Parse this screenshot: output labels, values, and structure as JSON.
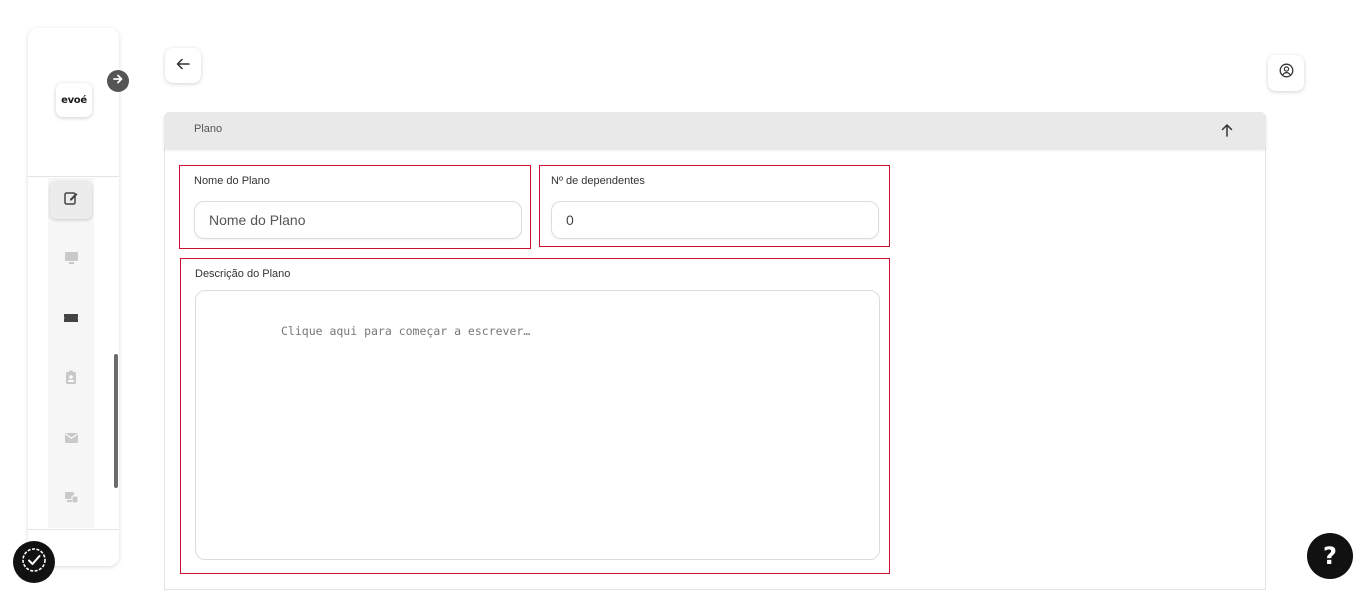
{
  "brand": {
    "logo_text": "evoé"
  },
  "sidebar": {
    "items": [
      {
        "name": "edit",
        "icon": "edit-icon",
        "active": true
      },
      {
        "name": "monitor",
        "icon": "monitor-icon",
        "active": false
      },
      {
        "name": "ticket",
        "icon": "ticket-icon",
        "active": false
      },
      {
        "name": "badge",
        "icon": "id-badge-icon",
        "active": false
      },
      {
        "name": "mail",
        "icon": "envelope-icon",
        "active": false
      },
      {
        "name": "devices",
        "icon": "devices-icon",
        "active": false
      }
    ]
  },
  "panel": {
    "title": "Plano",
    "fields": {
      "plan_name": {
        "label": "Nome do Plano",
        "value": "",
        "placeholder": "Nome do Plano"
      },
      "dependents": {
        "label": "Nº de dependentes",
        "value": "0",
        "placeholder": ""
      },
      "description": {
        "label": "Descrição do Plano",
        "placeholder": "Clique aqui para começar a escrever…"
      }
    }
  },
  "help": {
    "label": "?"
  },
  "colors": {
    "accent_border": "#c8102e",
    "header_bg": "#e9e9e9",
    "dark": "#111111"
  }
}
